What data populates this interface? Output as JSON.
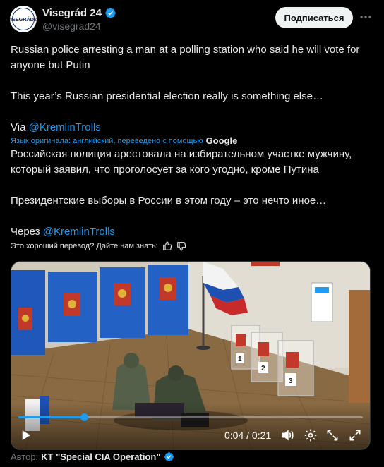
{
  "post": {
    "avatar_text_main": "VISEGRÁD",
    "avatar_text_num": "24",
    "display_name": "Visegrád 24",
    "handle": "@visegrad24",
    "subscribe_label": "Подписаться",
    "text_en_line1": "Russian police arresting a man at a polling station who said he will vote for anyone but Putin",
    "text_en_line2": "This year’s Russian presidential election really is something else…",
    "via_label": "Via",
    "mention": "@KremlinTrolls",
    "translated_label": "Язык оригинала: английский, переведено с помощью",
    "translated_provider": "Google",
    "text_ru_line1": "Российская полиция арестовала на избирательном участке мужчину, который заявил, что проголосует за кого угодно, кроме Путина",
    "text_ru_line2": "Президентские выборы в России в этом году – это нечто иное…",
    "via_ru_label": "Через",
    "rate_translation": "Это хороший перевод? Дайте нам знать:"
  },
  "video": {
    "current_time": "0:04",
    "separator": "/",
    "duration": "0:21",
    "progress_fraction": 0.19,
    "ballot_numbers": [
      "1",
      "2",
      "3"
    ]
  },
  "author": {
    "label": "Автор:",
    "name": "KT \"Special CIA Operation\""
  },
  "colors": {
    "accent": "#1d9bf0",
    "background": "#000000",
    "text": "#e7e9ea",
    "muted": "#71767b"
  }
}
